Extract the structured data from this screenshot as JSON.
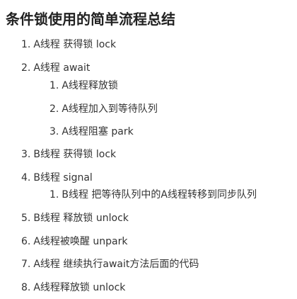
{
  "document": {
    "title": "条件锁使用的简单流程总结",
    "steps": [
      {
        "number": "1.",
        "text": "A线程 获得锁 lock"
      },
      {
        "number": "2.",
        "text": "A线程 await",
        "substeps": [
          {
            "number": "1.",
            "text": "A线程释放锁"
          },
          {
            "number": "2.",
            "text": "A线程加入到等待队列"
          },
          {
            "number": "3.",
            "text": "A线程阻塞 park"
          }
        ]
      },
      {
        "number": "3.",
        "text": "B线程 获得锁 lock"
      },
      {
        "number": "4.",
        "text": "B线程 signal",
        "substeps": [
          {
            "number": "1.",
            "text": "B线程 把等待队列中的A线程转移到同步队列"
          }
        ]
      },
      {
        "number": "5.",
        "text": "B线程 释放锁 unlock"
      },
      {
        "number": "6.",
        "text": "A线程被唤醒 unpark"
      },
      {
        "number": "7.",
        "text": "A线程 继续执行await方法后面的代码"
      },
      {
        "number": "8.",
        "text": "A线程释放锁 unlock"
      }
    ]
  }
}
